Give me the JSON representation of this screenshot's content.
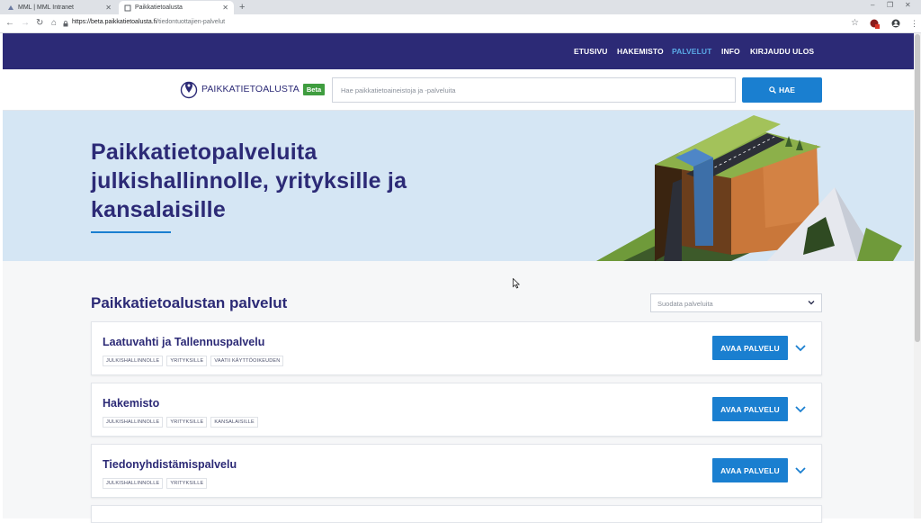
{
  "browser": {
    "tabs": [
      {
        "title": "MML | MML Intranet",
        "active": false
      },
      {
        "title": "Paikkatietoalusta",
        "active": true
      }
    ],
    "new_tab_glyph": "+",
    "url_main": "https://beta.paikkatietoalusta.fi",
    "url_path": "/tiedontuottajien-palvelut"
  },
  "nav": {
    "items": [
      "ETUSIVU",
      "HAKEMISTO",
      "PALVELUT",
      "INFO",
      "KIRJAUDU ULOS"
    ],
    "current": "PALVELUT"
  },
  "header": {
    "logo_text": "PAIKKATIETOALUSTA",
    "badge": "Beta",
    "search_placeholder": "Hae paikkatietoaineistoja ja -palveluita",
    "search_button": "HAE"
  },
  "hero": {
    "title_line1": "Paikkatietopalveluita",
    "title_line2": "julkishallinnolle, yrityksille ja",
    "title_line3": "kansalaisille"
  },
  "services": {
    "section_title": "Paikkatietoalustan palvelut",
    "filter_placeholder": "Suodata palveluita",
    "open_label": "AVAA PALVELU",
    "cards": [
      {
        "title": "Laatuvahti ja Tallennuspalvelu",
        "tags": [
          "JULKISHALLINNOLLE",
          "YRITYKSILLE",
          "VAATII KÄYTTÖOIKEUDEN"
        ]
      },
      {
        "title": "Hakemisto",
        "tags": [
          "JULKISHALLINNOLLE",
          "YRITYKSILLE",
          "KANSALAISILLE"
        ]
      },
      {
        "title": "Tiedonyhdistämispalvelu",
        "tags": [
          "JULKISHALLINNOLLE",
          "YRITYKSILLE"
        ]
      }
    ]
  },
  "colors": {
    "nav_bg": "#2c2a76",
    "accent": "#1a7fd0",
    "hero_bg": "#d5e6f4",
    "beta_green": "#3f9d3f",
    "active_nav": "#5aa9e6"
  }
}
